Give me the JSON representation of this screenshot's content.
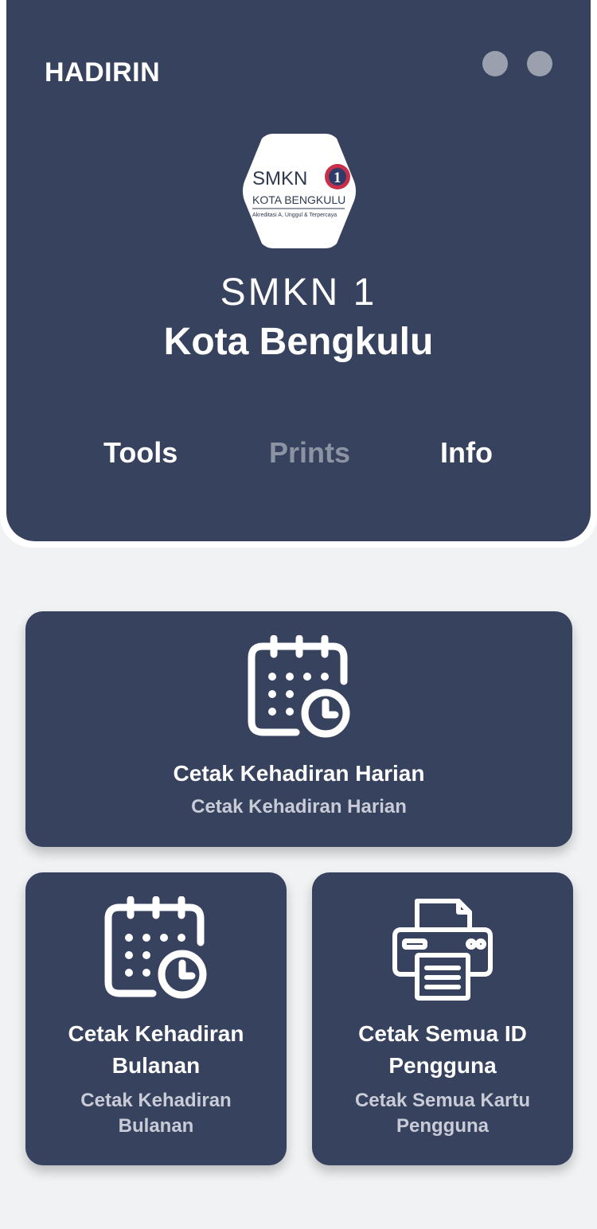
{
  "app": {
    "title": "HADIRIN"
  },
  "header": {
    "logo": {
      "line1": "SMKN",
      "badge": "1",
      "line2": "KOTA BENGKULU",
      "line3": "Akreditasi A, Unggul & Terpercaya"
    },
    "school_name_line1": "SMKN 1",
    "school_name_line2": "Kota Bengkulu"
  },
  "tabs": [
    {
      "label": "Tools",
      "active": false
    },
    {
      "label": "Prints",
      "active": true
    },
    {
      "label": "Info",
      "active": false
    }
  ],
  "cards": {
    "daily": {
      "title": "Cetak Kehadiran Harian",
      "subtitle": "Cetak Kehadiran Harian",
      "icon": "calendar-clock-icon"
    },
    "monthly": {
      "title": "Cetak Kehadiran Bulanan",
      "subtitle": "Cetak Kehadiran Bulanan",
      "icon": "calendar-clock-icon"
    },
    "ids": {
      "title": "Cetak Semua ID Pengguna",
      "subtitle": "Cetak Semua Kartu Pengguna",
      "icon": "printer-icon"
    }
  },
  "colors": {
    "primary": "#36425e",
    "background": "#f1f2f4",
    "tab_inactive": "#8c93a3",
    "subtitle": "#c9ccd6"
  }
}
